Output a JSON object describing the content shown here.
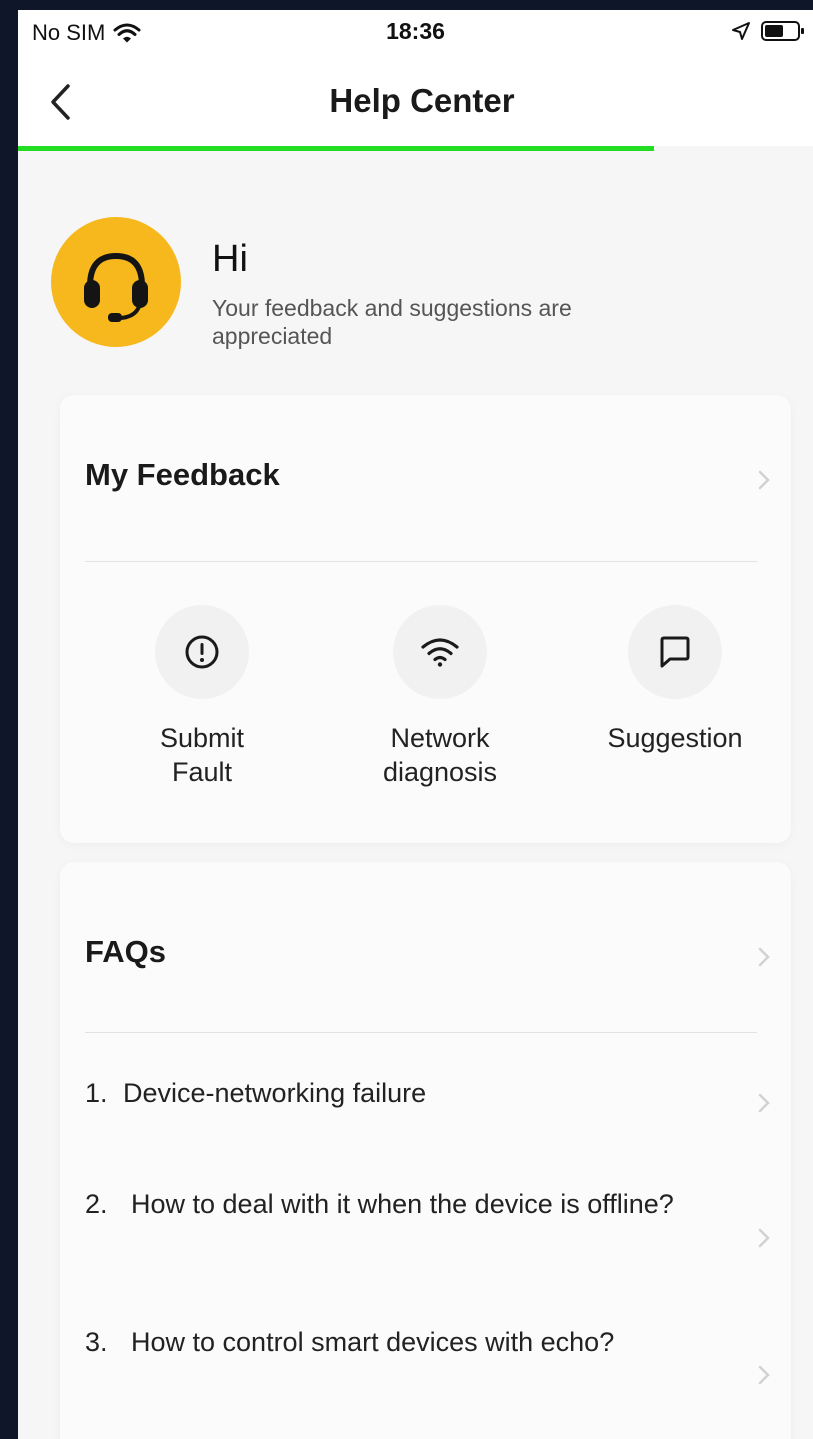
{
  "status_bar": {
    "carrier": "No SIM",
    "time": "18:36"
  },
  "nav": {
    "title": "Help Center",
    "load_progress": 0.8
  },
  "greeting": {
    "title": "Hi",
    "subtitle": "Your feedback and suggestions are appreciated"
  },
  "feedback": {
    "header": "My Feedback",
    "actions": [
      {
        "label": "Submit\nFault",
        "icon": "exclamation-circle-icon"
      },
      {
        "label": "Network\ndiagnosis",
        "icon": "wifi-icon"
      },
      {
        "label": "Suggestion",
        "icon": "speech-bubble-icon"
      }
    ]
  },
  "faqs": {
    "header": "FAQs",
    "items": [
      {
        "num": "1.",
        "text": "Device-networking failure"
      },
      {
        "num": "2.",
        "text": "How to deal with it when the device is offline?"
      },
      {
        "num": "3.",
        "text": "How to control smart devices with echo?"
      }
    ]
  },
  "colors": {
    "accent_green": "#22dd22",
    "avatar_yellow": "#f6b81c"
  }
}
